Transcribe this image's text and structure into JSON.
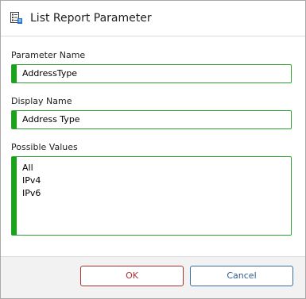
{
  "dialog": {
    "title": "List Report Parameter",
    "icon": "list-report-icon"
  },
  "fields": {
    "parameter_name": {
      "label": "Parameter Name",
      "value": "AddressType"
    },
    "display_name": {
      "label": "Display Name",
      "value": "Address Type"
    },
    "possible_values": {
      "label": "Possible Values",
      "values": [
        "All",
        "IPv4",
        "IPv6"
      ]
    }
  },
  "buttons": {
    "ok_label": "OK",
    "cancel_label": "Cancel"
  },
  "colors": {
    "field_border": "#2ea12e",
    "field_accent": "#16a516",
    "ok_button": "#a83232",
    "cancel_button": "#3a6ea5"
  }
}
